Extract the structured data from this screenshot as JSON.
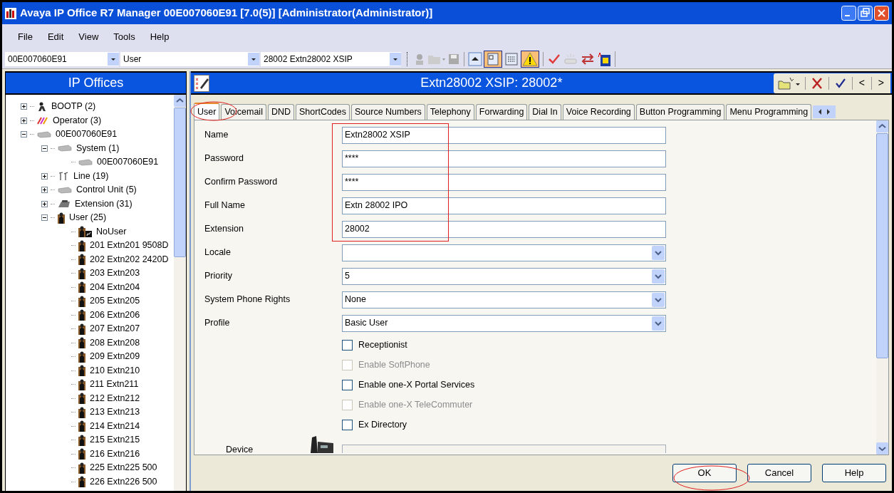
{
  "window": {
    "title": "Avaya IP Office R7 Manager 00E007060E91 [7.0(5)] [Administrator(Administrator)]"
  },
  "menu": [
    "File",
    "Edit",
    "View",
    "Tools",
    "Help"
  ],
  "toolbar": {
    "selectors": [
      "00E007060E91",
      "User",
      "28002 Extn28002 XSIP"
    ]
  },
  "navigator": {
    "title": "IP Offices",
    "tree": [
      {
        "label": "BOOTP (2)",
        "kind": "bootp",
        "expanded": false
      },
      {
        "label": "Operator (3)",
        "kind": "operator",
        "expanded": false
      },
      {
        "label": "00E007060E91",
        "kind": "unit",
        "expanded": true,
        "children": [
          {
            "label": "System (1)",
            "kind": "unit",
            "expanded": true,
            "children": [
              {
                "label": "00E007060E91",
                "kind": "unit"
              }
            ]
          },
          {
            "label": "Line (19)",
            "kind": "line",
            "expanded": false
          },
          {
            "label": "Control Unit (5)",
            "kind": "control",
            "expanded": false
          },
          {
            "label": "Extension (31)",
            "kind": "extension",
            "expanded": false
          },
          {
            "label": "User (25)",
            "kind": "user",
            "expanded": true,
            "children": [
              {
                "label": "NoUser",
                "kind": "nouser"
              },
              {
                "label": "201 Extn201 9508D",
                "kind": "user"
              },
              {
                "label": "202 Extn202 2420D",
                "kind": "user"
              },
              {
                "label": "203 Extn203",
                "kind": "user"
              },
              {
                "label": "204 Extn204",
                "kind": "user"
              },
              {
                "label": "205 Extn205",
                "kind": "user"
              },
              {
                "label": "206 Extn206",
                "kind": "user"
              },
              {
                "label": "207 Extn207",
                "kind": "user"
              },
              {
                "label": "208 Extn208",
                "kind": "user"
              },
              {
                "label": "209 Extn209",
                "kind": "user"
              },
              {
                "label": "210 Extn210",
                "kind": "user"
              },
              {
                "label": "211 Extn211",
                "kind": "user"
              },
              {
                "label": "212 Extn212",
                "kind": "user"
              },
              {
                "label": "213 Extn213",
                "kind": "user"
              },
              {
                "label": "214 Extn214",
                "kind": "user"
              },
              {
                "label": "215 Extn215",
                "kind": "user"
              },
              {
                "label": "216 Extn216",
                "kind": "user"
              },
              {
                "label": "225 Extn225 500",
                "kind": "user"
              },
              {
                "label": "226 Extn226 500",
                "kind": "user"
              }
            ]
          }
        ]
      }
    ]
  },
  "editor": {
    "title": "Extn28002 XSIP: 28002*",
    "nav_buttons": [
      "<",
      ">"
    ],
    "tabs": [
      {
        "label": "User",
        "selected": true
      },
      {
        "label": "Voicemail",
        "selected": false
      },
      {
        "label": "DND",
        "selected": false
      },
      {
        "label": "ShortCodes",
        "selected": false
      },
      {
        "label": "Source Numbers",
        "selected": false
      },
      {
        "label": "Telephony",
        "selected": false
      },
      {
        "label": "Forwarding",
        "selected": false
      },
      {
        "label": "Dial In",
        "selected": false
      },
      {
        "label": "Voice Recording",
        "selected": false
      },
      {
        "label": "Button Programming",
        "selected": false
      },
      {
        "label": "Menu Programming",
        "selected": false
      }
    ],
    "fields": [
      {
        "kind": "text",
        "label": "Name",
        "value": "Extn28002 XSIP"
      },
      {
        "kind": "text",
        "label": "Password",
        "value": "****"
      },
      {
        "kind": "text",
        "label": "Confirm Password",
        "value": "****"
      },
      {
        "kind": "text",
        "label": "Full Name",
        "value": "Extn 28002 IPO"
      },
      {
        "kind": "text",
        "label": "Extension",
        "value": "28002"
      },
      {
        "kind": "select",
        "label": "Locale"
      },
      {
        "kind": "select",
        "label": "Priority",
        "value": "5"
      },
      {
        "kind": "select",
        "label": "System Phone Rights",
        "value": "None"
      },
      {
        "kind": "select",
        "label": "Profile",
        "value": "Basic User"
      },
      {
        "kind": "checkbox",
        "label": "Receptionist",
        "checked": false,
        "disabled": false
      },
      {
        "kind": "checkbox",
        "label": "Enable SoftPhone",
        "checked": false,
        "disabled": true
      },
      {
        "kind": "checkbox",
        "label": "Enable one-X Portal Services",
        "checked": false,
        "disabled": false
      },
      {
        "kind": "checkbox",
        "label": "Enable one-X TeleCommuter",
        "checked": false,
        "disabled": true
      },
      {
        "kind": "checkbox",
        "label": "Ex Directory",
        "checked": false,
        "disabled": false
      },
      {
        "kind": "device",
        "label": "Device"
      }
    ],
    "buttons": [
      "OK",
      "Cancel",
      "Help"
    ]
  }
}
